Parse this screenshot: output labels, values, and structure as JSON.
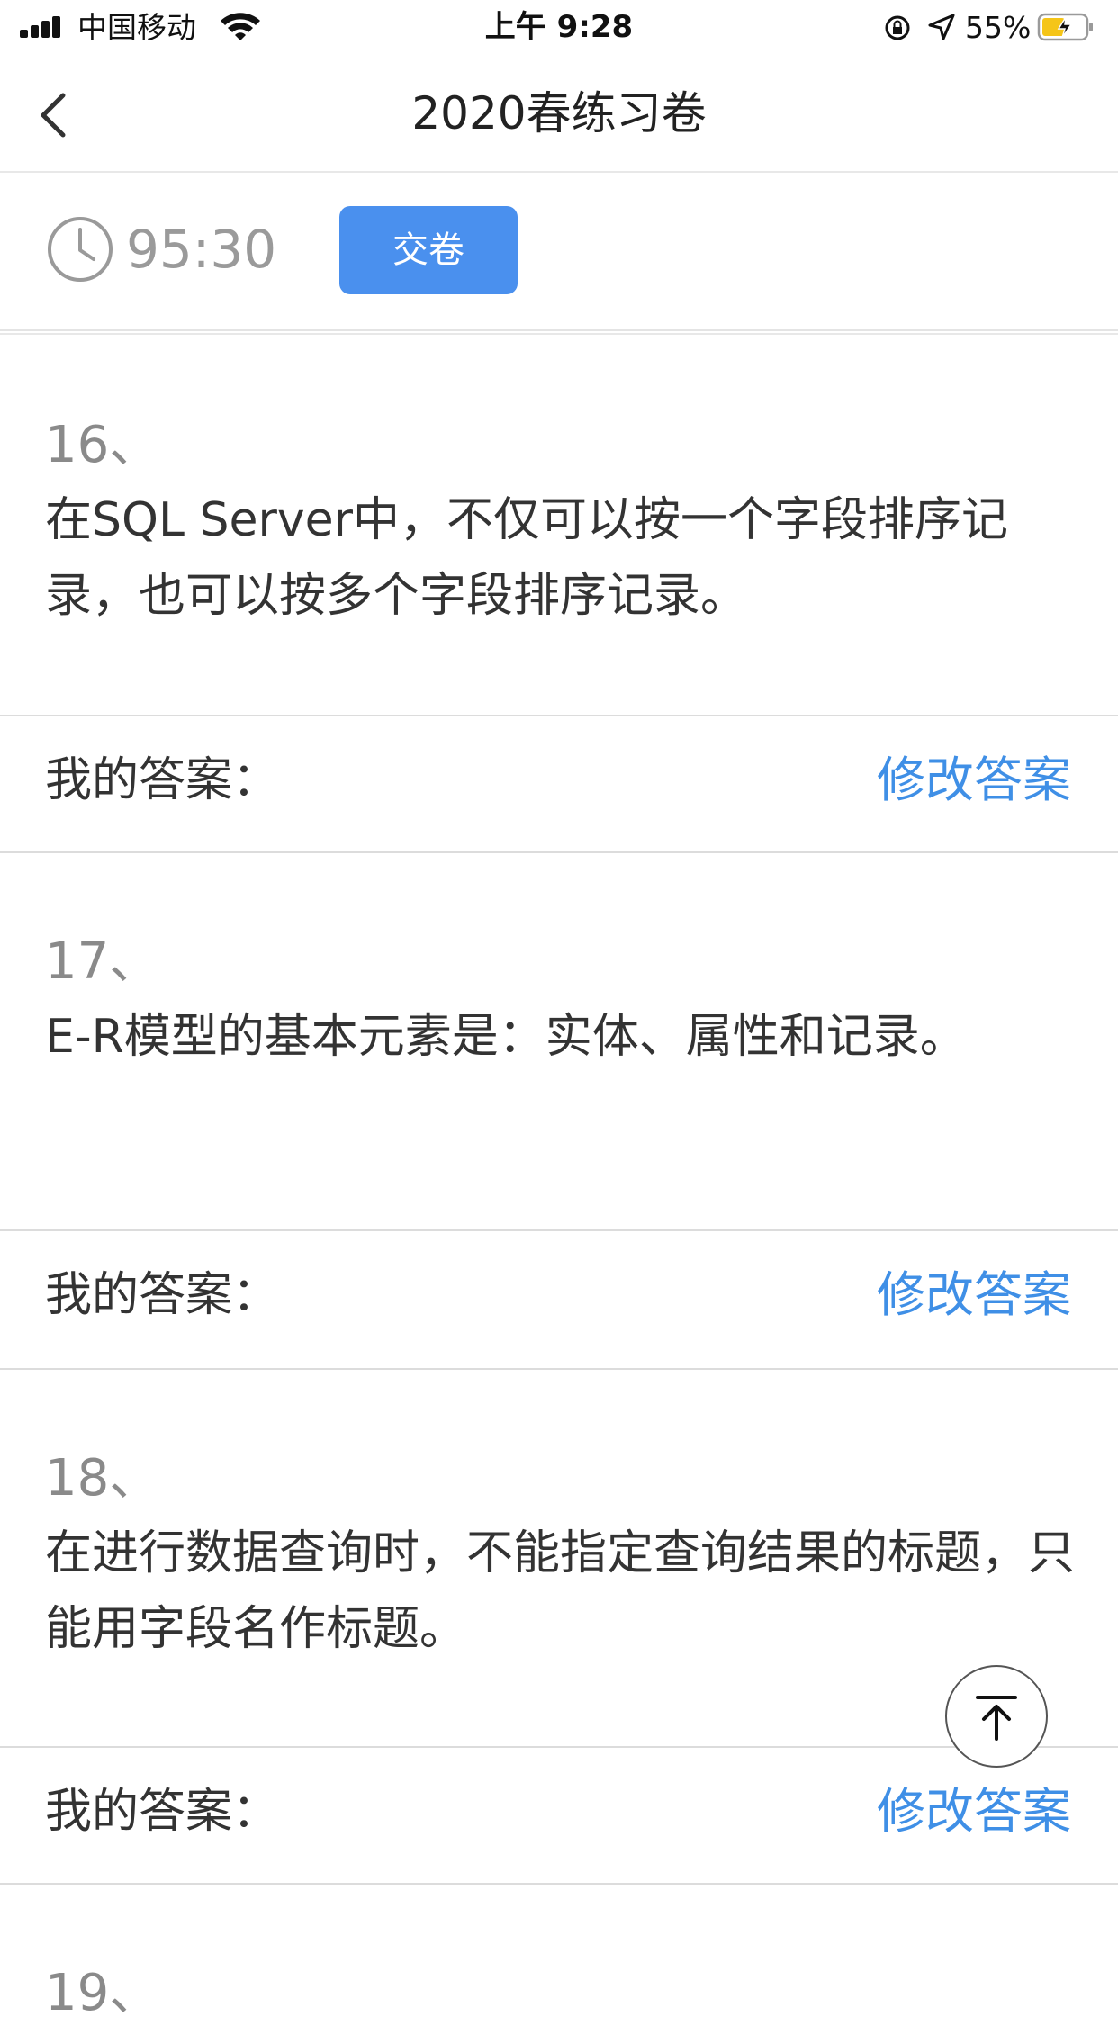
{
  "status_bar": {
    "carrier": "中国移动",
    "time": "上午 9:28",
    "battery_percent": "55%",
    "battery_level": 0.55,
    "battery_color": "#f5c518"
  },
  "nav": {
    "title": "2020春练习卷"
  },
  "timer": {
    "remaining": "95:30",
    "submit_label": "交卷"
  },
  "questions": [
    {
      "number": "16、",
      "text": "在SQL Server中，不仅可以按一个字段排序记录，也可以按多个字段排序记录。",
      "answer_label": "我的答案：",
      "modify_label": "修改答案"
    },
    {
      "number": "17、",
      "text": "E-R模型的基本元素是：实体、属性和记录。",
      "answer_label": "我的答案：",
      "modify_label": "修改答案"
    },
    {
      "number": "18、",
      "text": "在进行数据查询时，不能指定查询结果的标题，只能用字段名作标题。",
      "answer_label": "我的答案：",
      "modify_label": "修改答案"
    },
    {
      "number": "19、"
    }
  ],
  "colors": {
    "accent": "#4a90ee",
    "link": "#3f8fe6"
  },
  "icons": [
    "signal-icon",
    "wifi-icon",
    "orientation-lock-icon",
    "location-icon",
    "battery-icon",
    "back-icon",
    "clock-icon",
    "back-to-top-icon"
  ]
}
